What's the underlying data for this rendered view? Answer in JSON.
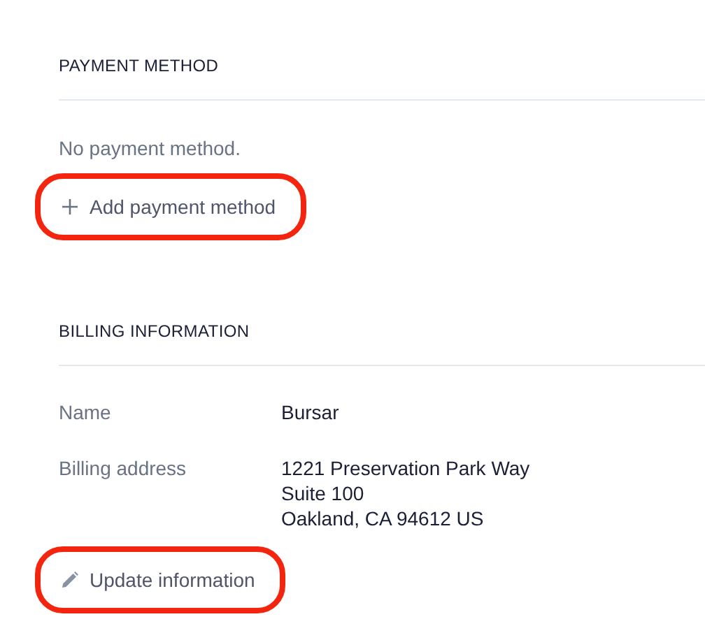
{
  "sections": [
    {
      "kind": "payment",
      "heading": "PAYMENT METHOD",
      "empty_text": "No payment method.",
      "action": {
        "kind": "add",
        "label": "Add payment method",
        "highlighted": true
      }
    },
    {
      "kind": "billing",
      "heading": "BILLING INFORMATION",
      "fields": [
        {
          "label": "Name",
          "lines": [
            "Bursar"
          ]
        },
        {
          "label": "Billing address",
          "lines": [
            "1221 Preservation Park Way",
            "Suite 100",
            "Oakland, CA 94612 US"
          ]
        }
      ],
      "action": {
        "kind": "edit",
        "label": "Update information",
        "highlighted": true
      }
    }
  ]
}
